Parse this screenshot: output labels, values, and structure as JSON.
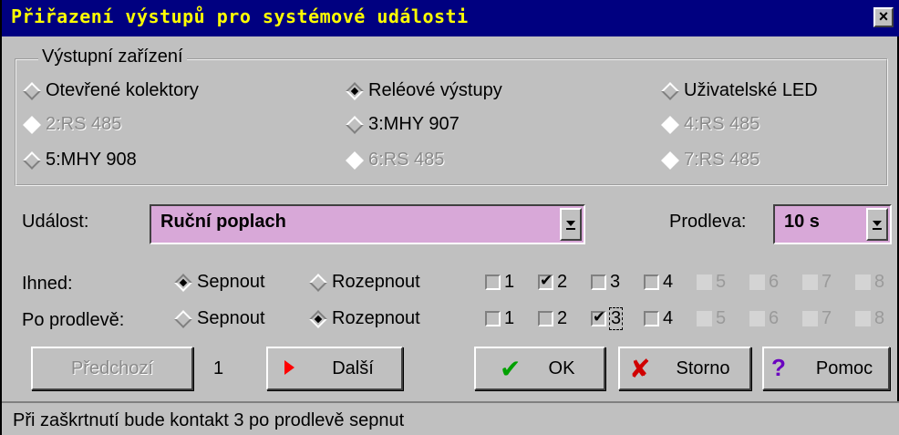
{
  "window": {
    "title": "Přiřazení výstupů pro systémové události"
  },
  "output_devices": {
    "label": "Výstupní zařízení",
    "options": [
      {
        "label": "Otevřené kolektory",
        "selected": false,
        "enabled": true
      },
      {
        "label": "Reléové výstupy",
        "selected": true,
        "enabled": true
      },
      {
        "label": "Uživatelské LED",
        "selected": false,
        "enabled": true
      },
      {
        "label": "2:RS 485",
        "selected": false,
        "enabled": false
      },
      {
        "label": "3:MHY 907",
        "selected": false,
        "enabled": true
      },
      {
        "label": "4:RS 485",
        "selected": false,
        "enabled": false
      },
      {
        "label": "5:MHY 908",
        "selected": false,
        "enabled": true
      },
      {
        "label": "6:RS 485",
        "selected": false,
        "enabled": false
      },
      {
        "label": "7:RS 485",
        "selected": false,
        "enabled": false
      }
    ]
  },
  "event": {
    "label": "Událost:",
    "value": "Ruční poplach"
  },
  "delay": {
    "label": "Prodleva:",
    "value": "10 s"
  },
  "immediate": {
    "label": "Ihned:",
    "close_label": "Sepnout",
    "open_label": "Rozepnout",
    "contacts": [
      "1",
      "2",
      "3",
      "4",
      "5",
      "6",
      "7",
      "8"
    ]
  },
  "after_delay": {
    "label": "Po prodlevě:",
    "close_label": "Sepnout",
    "open_label": "Rozepnout",
    "contacts": [
      "1",
      "2",
      "3",
      "4",
      "5",
      "6",
      "7",
      "8"
    ]
  },
  "nav": {
    "prev_label": "Předchozí",
    "index": "1",
    "next_label": "Další"
  },
  "buttons": {
    "ok_label": "OK",
    "cancel_label": "Storno",
    "help_label": "Pomoc"
  },
  "status": {
    "text": "Při zaškrtnutí bude kontakt 3 po prodlevě sepnut"
  },
  "colors": {
    "title_bg": "#000080",
    "title_fg": "#ffff00",
    "combo_bg": "#d8a8d8",
    "face": "#c0c0c0"
  },
  "icons": {
    "ok": "green-check-icon",
    "cancel": "red-x-icon",
    "help": "question-mark-icon",
    "next": "red-triangle-icon",
    "close": "close-icon"
  }
}
